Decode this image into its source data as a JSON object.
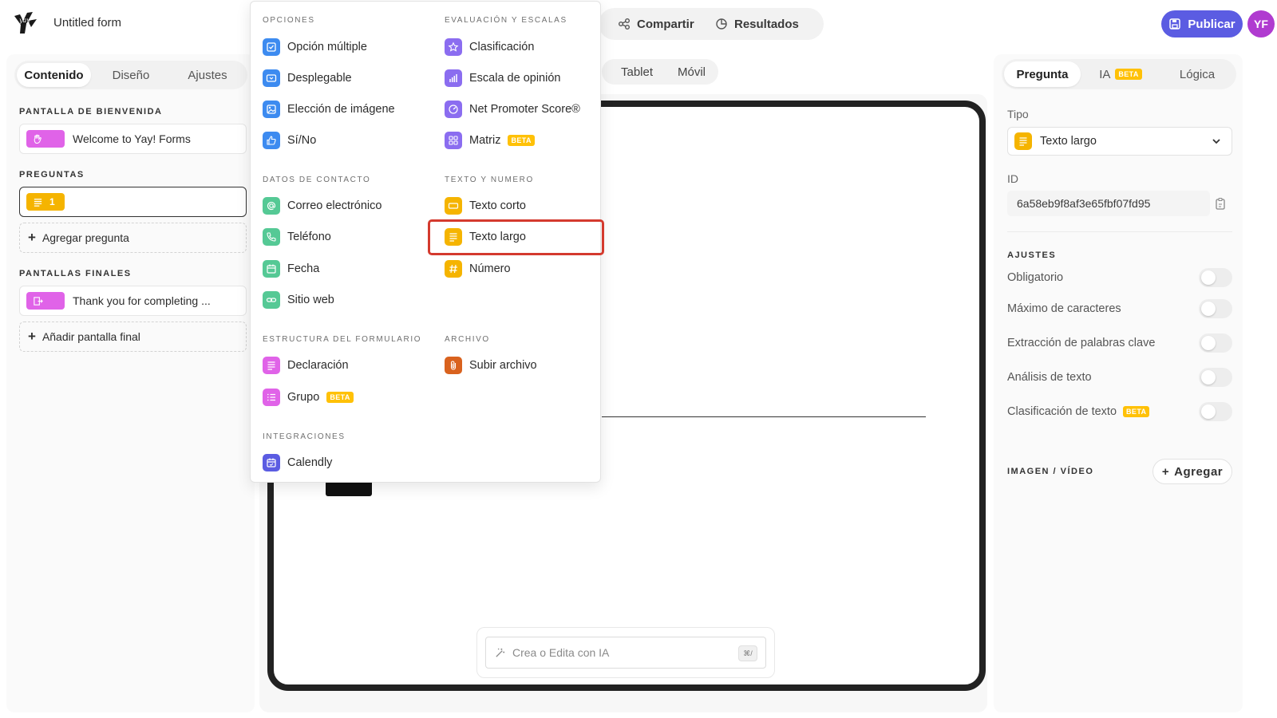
{
  "header": {
    "form_title": "Untitled form",
    "share_label": "Compartir",
    "results_label": "Resultados",
    "publish_label": "Publicar",
    "avatar_initials": "YF",
    "brand_color": "#5b5ce2"
  },
  "left": {
    "tabs": [
      "Contenido",
      "Diseño",
      "Ajustes"
    ],
    "welcome_section": "PANTALLA DE BIENVENIDA",
    "welcome_card": "Welcome to Yay! Forms",
    "questions_section": "PREGUNTAS",
    "question_number": "1",
    "add_question": "Agregar pregunta",
    "end_section": "PANTALLAS FINALES",
    "end_card": "Thank you for completing ...",
    "add_end": "Añadir pantalla final"
  },
  "center": {
    "device_tabs": [
      "Tablet",
      "Móvil"
    ],
    "ai_placeholder": "Crea o Edita con IA",
    "ai_shortcut": "⌘/"
  },
  "menu": {
    "beta": "BETA",
    "sections": {
      "options": "OPCIONES",
      "rating": "EVALUACIÓN Y ESCALAS",
      "contact": "DATOS DE CONTACTO",
      "text": "TEXTO Y NUMERO",
      "structure": "ESTRUCTURA DEL FORMULARIO",
      "file": "ARCHIVO",
      "integrations": "INTEGRACIONES"
    },
    "items": {
      "multiple_choice": "Opción múltiple",
      "dropdown": "Desplegable",
      "image_choice": "Elección de imágene",
      "yes_no": "Sí/No",
      "rating": "Clasificación",
      "opinion_scale": "Escala de opinión",
      "nps": "Net Promoter Score®",
      "matrix": "Matriz",
      "email": "Correo electrónico",
      "phone": "Teléfono",
      "date": "Fecha",
      "website": "Sitio web",
      "short_text": "Texto corto",
      "long_text": "Texto largo",
      "number": "Número",
      "statement": "Declaración",
      "group": "Grupo",
      "upload": "Subir archivo",
      "calendly": "Calendly"
    }
  },
  "right": {
    "tabs": [
      "Pregunta",
      "IA",
      "Lógica"
    ],
    "type_label": "Tipo",
    "type_value": "Texto largo",
    "id_label": "ID",
    "id_value": "6a58eb9f8af3e65fbf07fd95",
    "settings_section": "AJUSTES",
    "settings": [
      "Obligatorio",
      "Máximo de caracteres",
      "Extracción de palabras clave",
      "Análisis de texto",
      "Clasificación de texto"
    ],
    "media_section": "IMAGEN / VÍDEO",
    "add_label": "Agregar"
  }
}
